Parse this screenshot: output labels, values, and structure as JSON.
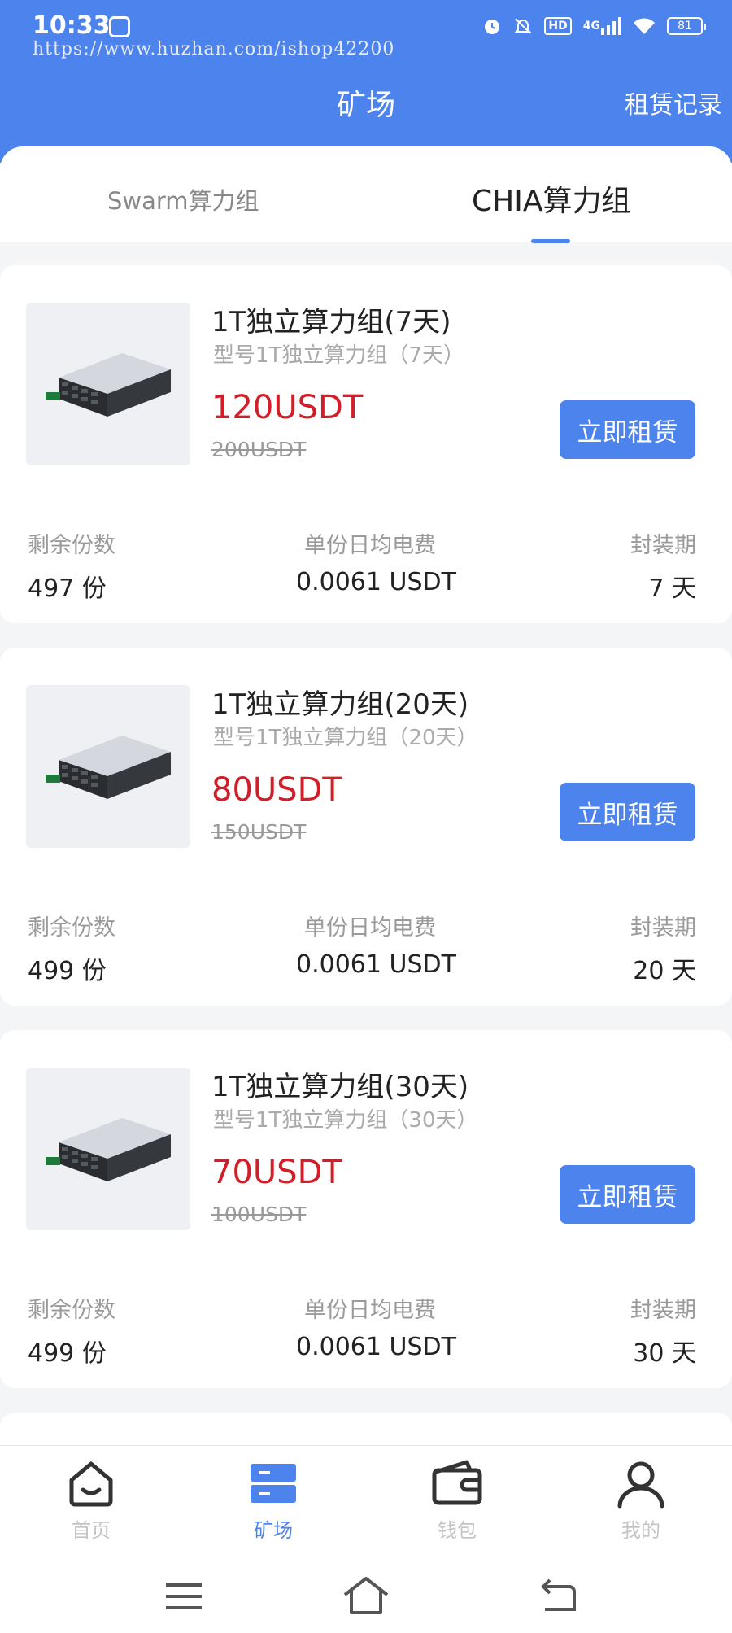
{
  "status_bar": {
    "time": "10:33",
    "network": "4G",
    "hd": "HD",
    "battery": "81",
    "icons": [
      "app-icon",
      "alarm-icon",
      "mute-icon",
      "hd-icon",
      "signal-icon",
      "wifi-icon",
      "battery-icon"
    ]
  },
  "watermark": "https://www.huzhan.com/ishop42200",
  "header": {
    "title": "矿场",
    "rental_record": "租赁记录"
  },
  "tabs": [
    {
      "label": "Swarm算力组",
      "active": false
    },
    {
      "label": "CHIA算力组",
      "active": true
    }
  ],
  "stat_labels": {
    "remaining": "剩余份数",
    "daily_fee": "单份日均电费",
    "lock_period": "封装期"
  },
  "products": [
    {
      "name": "1T独立算力组(7天)",
      "model": "型号1T独立算力组（7天）",
      "price": "120USDT",
      "original_price": "200USDT",
      "button": "立即租赁",
      "remaining": "497 份",
      "daily_fee": "0.0061 USDT",
      "lock_period": "7 天"
    },
    {
      "name": "1T独立算力组(20天)",
      "model": "型号1T独立算力组（20天）",
      "price": "80USDT",
      "original_price": "150USDT",
      "button": "立即租赁",
      "remaining": "499 份",
      "daily_fee": "0.0061 USDT",
      "lock_period": "20 天"
    },
    {
      "name": "1T独立算力组(30天)",
      "model": "型号1T独立算力组（30天）",
      "price": "70USDT",
      "original_price": "100USDT",
      "button": "立即租赁",
      "remaining": "499 份",
      "daily_fee": "0.0061 USDT",
      "lock_period": "30 天"
    }
  ],
  "bottom_nav": [
    {
      "label": "首页",
      "icon": "home-icon",
      "active": false
    },
    {
      "label": "矿场",
      "icon": "mine-icon",
      "active": true
    },
    {
      "label": "钱包",
      "icon": "wallet-icon",
      "active": false
    },
    {
      "label": "我的",
      "icon": "user-icon",
      "active": false
    }
  ],
  "system_nav": [
    "menu-icon",
    "home-outline-icon",
    "back-icon"
  ],
  "colors": {
    "primary": "#4d83ec",
    "price_red": "#d11e28",
    "background": "#f4f5f7"
  }
}
